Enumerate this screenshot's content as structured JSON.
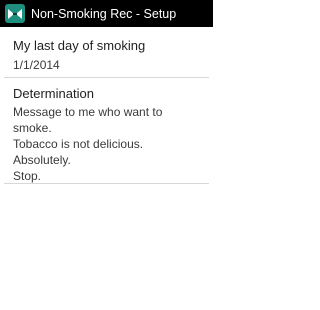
{
  "action_bar": {
    "icon": "no-smoking-app-icon",
    "title": "Non-Smoking Rec - Setup"
  },
  "preferences": {
    "last_day": {
      "title": "My last day of smoking",
      "value": "1/1/2014"
    },
    "determination": {
      "title": "Determination",
      "lines": [
        "Message to me who want to",
        "smoke.",
        "Tobacco is not delicious.",
        "Absolutely.",
        "Stop."
      ]
    }
  },
  "colors": {
    "action_bar_bg": "#000000",
    "icon_bg": "#1e8f7e",
    "background": "#ffffff",
    "divider": "#d8d8d8"
  }
}
